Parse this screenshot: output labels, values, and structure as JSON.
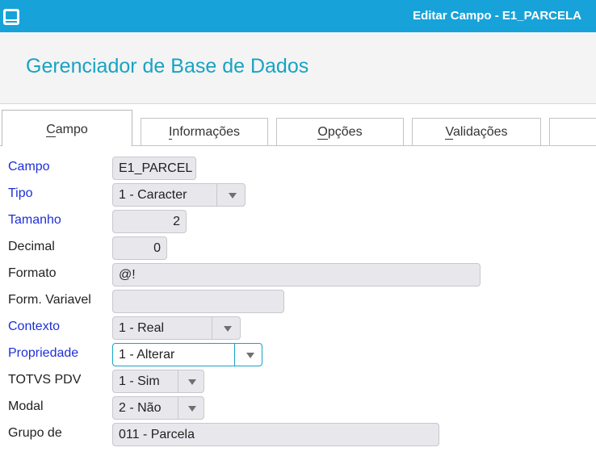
{
  "window": {
    "title": "Editar Campo - E1_PARCELA",
    "icon": "app-window-icon"
  },
  "header": {
    "title": "Gerenciador de Base de Dados"
  },
  "tabs": [
    {
      "label": "Campo",
      "active": true
    },
    {
      "label": "Informações",
      "active": false
    },
    {
      "label": "Opções",
      "active": false
    },
    {
      "label": "Validações",
      "active": false
    }
  ],
  "form": {
    "campo": {
      "label": "Campo",
      "value": "E1_PARCEL"
    },
    "tipo": {
      "label": "Tipo",
      "value": "1 - Caracter"
    },
    "tamanho": {
      "label": "Tamanho",
      "value": "2"
    },
    "decimal": {
      "label": "Decimal",
      "value": "0"
    },
    "formato": {
      "label": "Formato",
      "value": "@!"
    },
    "form_variavel": {
      "label": "Form. Variavel",
      "value": ""
    },
    "contexto": {
      "label": "Contexto",
      "value": "1 - Real"
    },
    "propriedade": {
      "label": "Propriedade",
      "value": "1 - Alterar"
    },
    "totvs_pdv": {
      "label": "TOTVS PDV",
      "value": "1 - Sim"
    },
    "modal": {
      "label": "Modal",
      "value": "2 - Não"
    },
    "grupo": {
      "label": "Grupo de",
      "value": "011 - Parcela"
    }
  },
  "colors": {
    "titlebar": "#17a3d9",
    "header_title": "#17a3c4",
    "required_label": "#1f2fd6"
  }
}
